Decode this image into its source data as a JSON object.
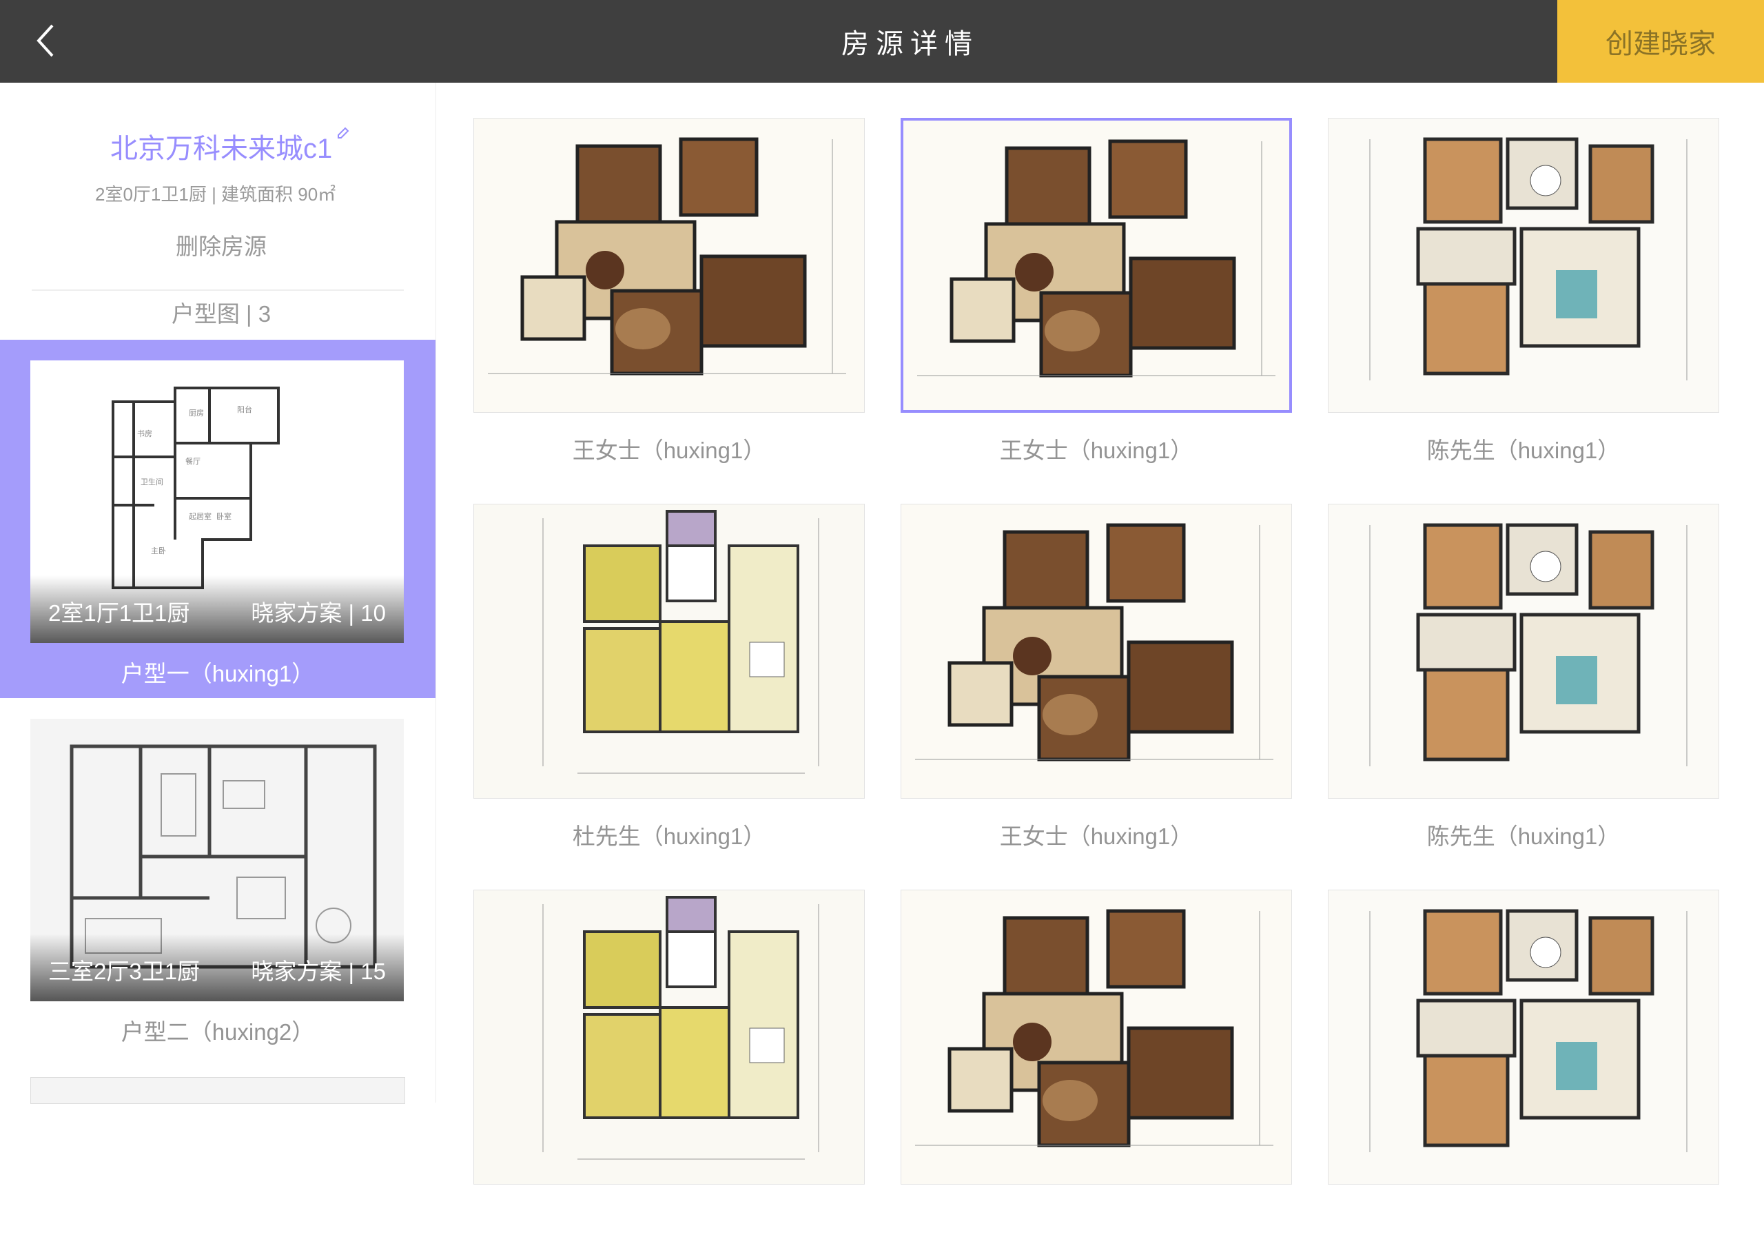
{
  "header": {
    "back_icon": "chevron-left-icon",
    "title": "房源详情",
    "create_button": "创建晓家"
  },
  "project": {
    "name": "北京万科未来城c1",
    "edit_icon": "edit-icon",
    "info": "2室0厅1卫1厨 | 建筑面积 90㎡",
    "delete_label": "删除房源",
    "type_count": "户型图 | 3"
  },
  "sidebar": {
    "items": [
      {
        "rooms": "2室1厅1卫1厨",
        "plans": "晓家方案 | 10",
        "label": "户型一（huxing1）"
      },
      {
        "rooms": "三室2厅3卫1厨",
        "plans": "晓家方案 | 15",
        "label": "户型二（huxing2）"
      }
    ]
  },
  "grid": {
    "items": [
      {
        "label": "王女士（huxing1）",
        "plan": "brown"
      },
      {
        "label": "王女士（huxing1）",
        "plan": "brown"
      },
      {
        "label": "陈先生（huxing1）",
        "plan": "tan"
      },
      {
        "label": "杜先生（huxing1）",
        "plan": "yellow"
      },
      {
        "label": "王女士（huxing1）",
        "plan": "brown"
      },
      {
        "label": "陈先生（huxing1）",
        "plan": "tan"
      },
      {
        "label": "",
        "plan": "yellow"
      },
      {
        "label": "",
        "plan": "brown"
      },
      {
        "label": "",
        "plan": "tan"
      }
    ]
  },
  "colors": {
    "header_bg": "#3f3f3f",
    "accent_yellow": "#f3c13a",
    "accent_purple": "#978dfe",
    "text_gray": "#999999"
  }
}
